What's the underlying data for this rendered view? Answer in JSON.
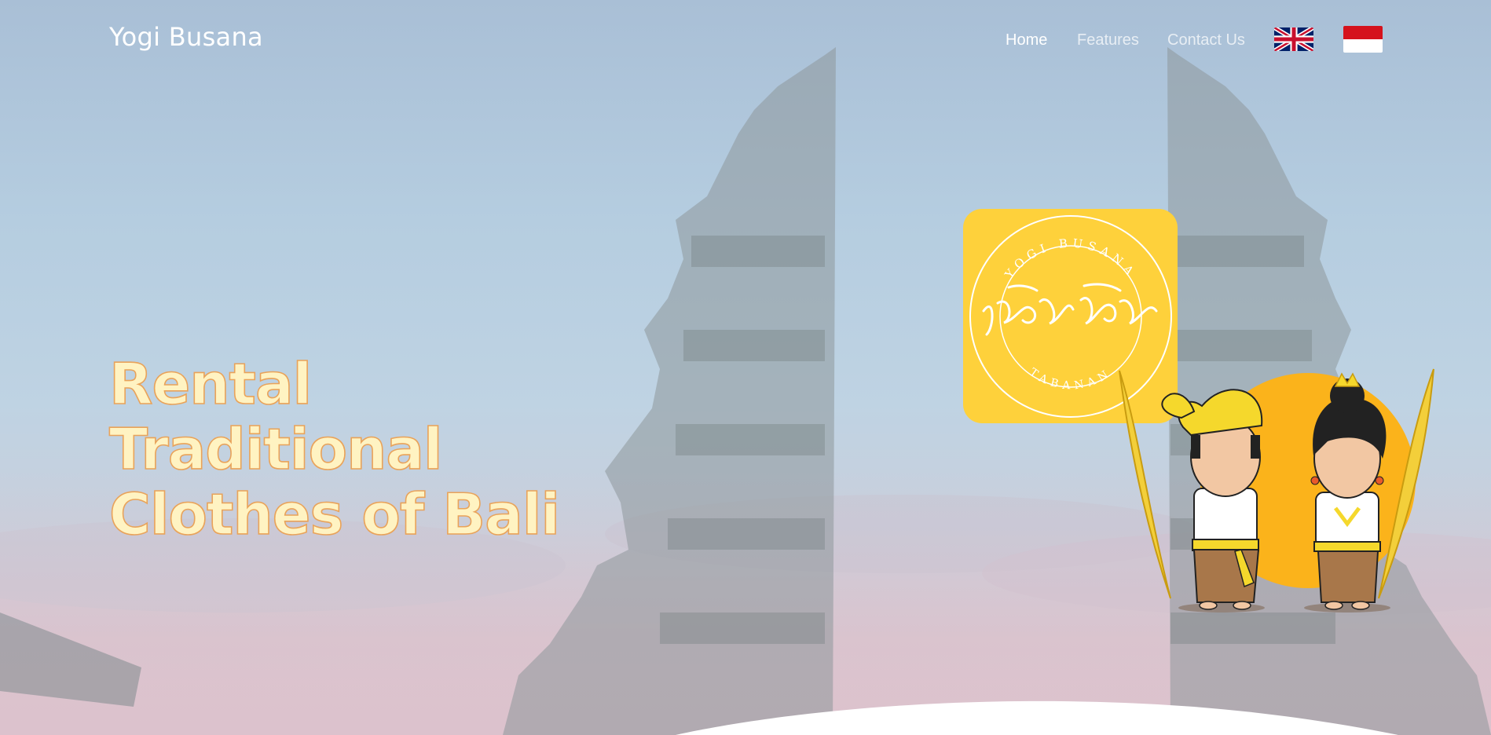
{
  "nav": {
    "brand": "Yogi Busana",
    "links": [
      {
        "label": "Home",
        "active": true
      },
      {
        "label": "Features",
        "active": false
      },
      {
        "label": "Contact Us",
        "active": false
      }
    ],
    "languages": [
      {
        "code": "en",
        "icon": "uk-flag-icon"
      },
      {
        "code": "id",
        "icon": "indonesia-flag-icon"
      }
    ]
  },
  "hero": {
    "headline_line1": "Rental Traditional",
    "headline_line2": "Clothes of Bali",
    "logo": {
      "top_text": "YOGI BUSANA",
      "bottom_text": "TABANAN",
      "bg_color": "#fed13b"
    }
  },
  "colors": {
    "headline_fill": "#fff3c2",
    "headline_stroke": "#e9a35a",
    "sun": "#fbb31b"
  }
}
